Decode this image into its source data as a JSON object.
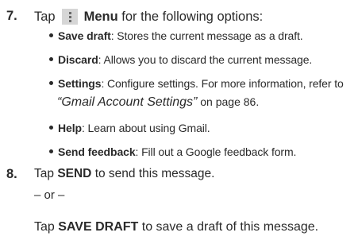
{
  "step7": {
    "number": "7.",
    "lead": "Tap",
    "menu_label": "Menu",
    "tail": "for the following options:",
    "menu_icon": "menu-dots-icon"
  },
  "options": [
    {
      "term": "Save draft",
      "desc": ": Stores the current message as a draft."
    },
    {
      "term": "Discard",
      "desc": ": Allows you to discard the current message."
    },
    {
      "term": "Settings",
      "desc": ": Configure settings. For more information, refer to"
    },
    {
      "term": "Help",
      "desc": ": Learn about using Gmail."
    },
    {
      "term": "Send feedback",
      "desc": ": Fill out a Google feedback form."
    }
  ],
  "settings_continuation": {
    "xref": "“Gmail Account Settings”",
    "page_ref": " on page 86."
  },
  "step8": {
    "number": "8.",
    "lead": "Tap ",
    "action": "SEND",
    "tail": " to send this message."
  },
  "or_line": "– or –",
  "draft_line": {
    "lead": "Tap ",
    "action": "SAVE DRAFT",
    "tail": " to save a draft of this message."
  }
}
